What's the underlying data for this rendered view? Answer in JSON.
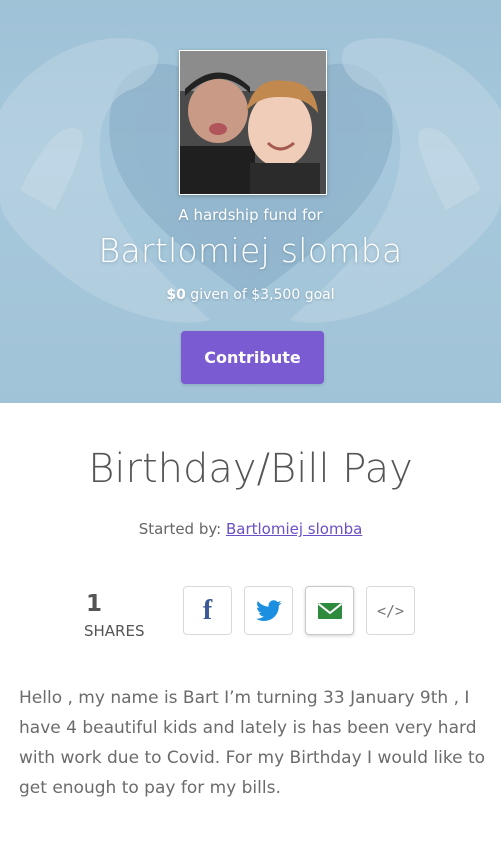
{
  "hero": {
    "subtitle": "A hardship fund for",
    "beneficiary": "Bartlomiej slomba",
    "given_amount": "$0",
    "goal_text": " given of $3,500 goal",
    "contribute_label": "Contribute",
    "photo": "beneficiary-photo"
  },
  "campaign": {
    "title": "Birthday/Bill Pay",
    "started_by_label": "Started by: ",
    "organizer": "Bartlomiej slomba"
  },
  "shares": {
    "count": "1",
    "label": "SHARES",
    "buttons": [
      {
        "icon": "facebook-icon",
        "color": "#3b5998"
      },
      {
        "icon": "twitter-icon",
        "color": "#1da1f2"
      },
      {
        "icon": "email-icon",
        "color": "#2e8b3e"
      },
      {
        "icon": "embed-code-icon",
        "glyph": "</>"
      }
    ]
  },
  "story": "Hello , my name is Bart I’m turning 33 January 9th , I have 4 beautiful kids and lately is has been very hard with work due to Covid. For my Birthday I would like to get enough to pay for my bills.",
  "colors": {
    "accent": "#7a5bd1",
    "link": "#6a4fc6",
    "hero_bg": "#a2c4d8"
  }
}
